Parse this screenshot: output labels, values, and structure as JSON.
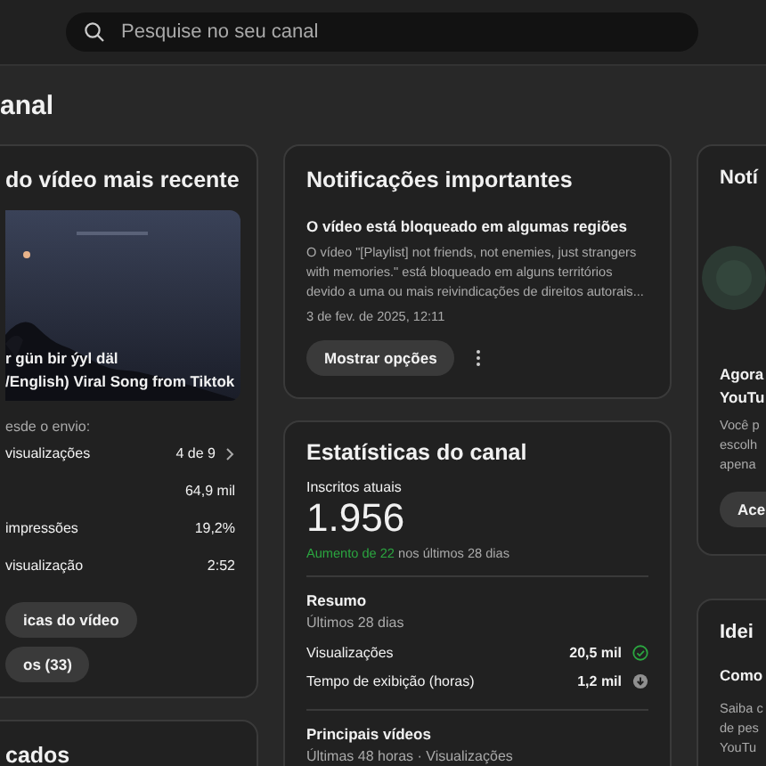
{
  "search": {
    "placeholder": "Pesquise no seu canal"
  },
  "page_title": "anal",
  "latest_video": {
    "title": "do vídeo mais recente",
    "thumbnail": {
      "kind": "picture"
    },
    "video_title": [
      "r gün bir ýyl däl",
      "/English) Viral Song from Tiktok"
    ],
    "since": "esde o envio:",
    "metrics": [
      {
        "label": "visualizações",
        "value": "4 de 9",
        "kind": "ranking"
      },
      {
        "value": "64,9 mil",
        "kind": "plain"
      },
      {
        "label": "impressões",
        "value": "19,2%",
        "kind": "plain"
      },
      {
        "label": "visualização",
        "value": "2:52",
        "kind": "plain"
      }
    ],
    "buttons": [
      "icas do vídeo",
      "os (33)"
    ]
  },
  "next_card": {
    "title": "cados"
  },
  "notifications": {
    "title": "Notificações importantes",
    "headline": "O vídeo está bloqueado em algumas regiões",
    "body": "O vídeo \"[Playlist] not friends, not enemies, just strangers with memories.\" está bloqueado em alguns territórios devido a uma ou mais reivindicações de direitos autorais...",
    "date": "3 de fev. de 2025, 12:11",
    "button": "Mostrar opções"
  },
  "channel_stats": {
    "title": "Estatísticas do canal",
    "subscribers_label": "Inscritos atuais",
    "subscribers": "1.956",
    "change_highlight": "Aumento de 22",
    "change_rest": "nos últimos 28 dias",
    "summary_title": "Resumo",
    "summary_period": "Últimos 28 dias",
    "rows": [
      {
        "label": "Visualizações",
        "value": "20,5 mil",
        "kind": "check"
      },
      {
        "label": "Tempo de exibição (horas)",
        "value": "1,2 mil",
        "kind": "down"
      }
    ],
    "top_title": "Principais vídeos",
    "top_period": "Últimas 48 horas · Visualizações"
  },
  "news": {
    "title": "Notí",
    "picture": {
      "kind": "picture"
    },
    "headline": [
      "Agora",
      "YouTu"
    ],
    "body": [
      "Você p",
      "escolh",
      "apena"
    ],
    "button": "Ace"
  },
  "ideas": {
    "title": "Idei",
    "headline": "Como",
    "body": [
      "Saiba c",
      "de pes",
      "YouTu"
    ]
  }
}
